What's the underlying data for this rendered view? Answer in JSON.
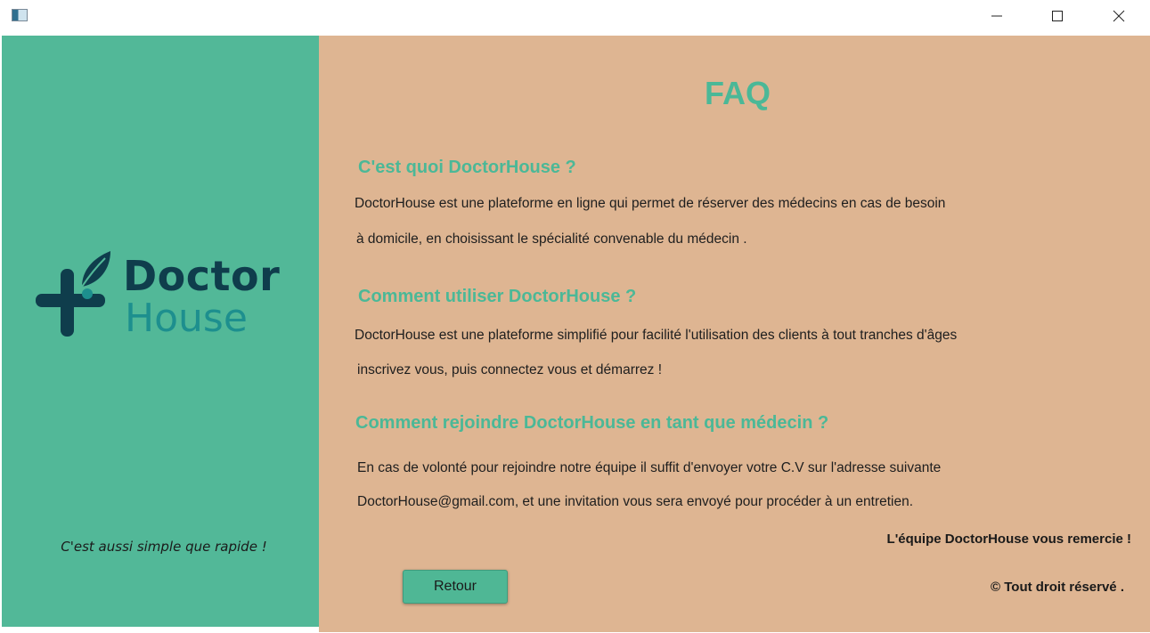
{
  "window": {
    "icon": "app-window-icon",
    "controls": [
      "minimize-icon",
      "maximize-icon",
      "close-icon"
    ]
  },
  "sidebar": {
    "logo": {
      "line1": "Doctor",
      "line2": "House",
      "icon": "medical-cross-leaf-icon",
      "colors": {
        "cross": "#0f3d4c",
        "leaf": "#0f3d4c",
        "house": "#1d8f8e"
      }
    },
    "slogan": "C'est aussi simple que rapide !",
    "background": "#52b898"
  },
  "main": {
    "background": "#deb592",
    "title": "FAQ",
    "accent": "#4bb897",
    "faq": [
      {
        "question": "C'est quoi DoctorHouse ?",
        "answer_line1": "DoctorHouse est une plateforme en ligne qui permet de réserver des médecins en cas de besoin",
        "answer_line2": "à domicile, en choisissant le spécialité convenable du médecin ."
      },
      {
        "question": "Comment utiliser DoctorHouse ?",
        "answer_line1": "DoctorHouse est une plateforme simplifié pour facilité l'utilisation des clients à tout tranches d'âges",
        "answer_line2": "inscrivez vous, puis connectez vous et démarrez !"
      },
      {
        "question": "Comment rejoindre DoctorHouse en tant que médecin ?",
        "answer_line1": "En cas de volonté pour rejoindre notre équipe il suffit d'envoyer votre C.V sur l'adresse suivante",
        "answer_line2": "DoctorHouse@gmail.com, et une invitation vous sera envoyé pour procéder à un entretien."
      }
    ],
    "thanks": "L'équipe DoctorHouse vous remercie !",
    "copyright": "© Tout droit réservé .",
    "back_button": "Retour"
  }
}
